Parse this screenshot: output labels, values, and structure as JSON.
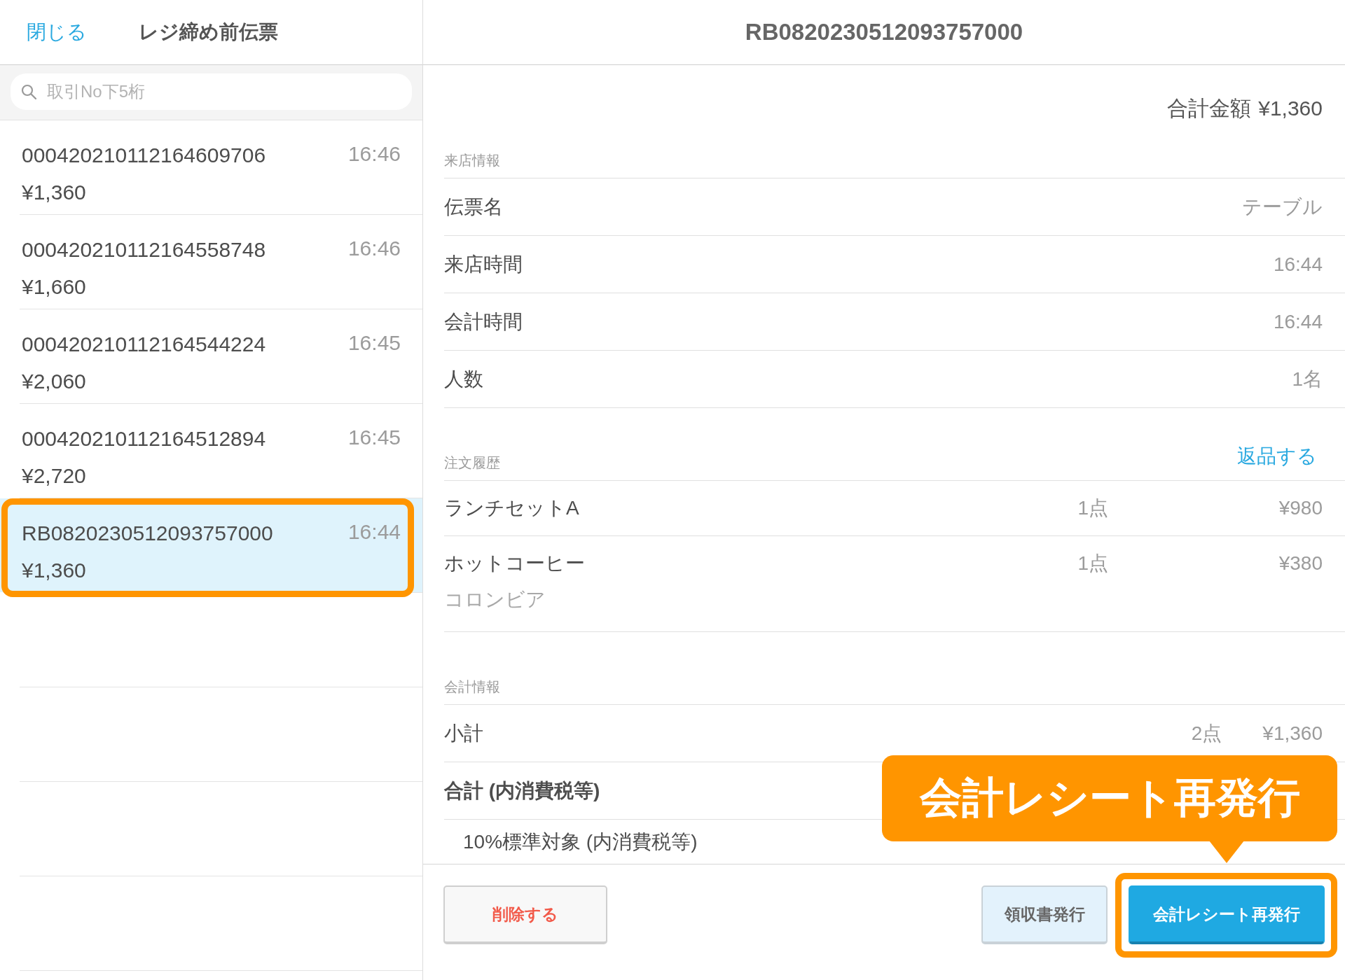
{
  "header": {
    "close_label": "閉じる",
    "title": "レジ締め前伝票"
  },
  "search": {
    "placeholder": "取引No下5桁"
  },
  "slips": [
    {
      "number": "000420210112164609706",
      "time": "16:46",
      "amount": "¥1,360",
      "selected": false,
      "highlighted": false
    },
    {
      "number": "000420210112164558748",
      "time": "16:46",
      "amount": "¥1,660",
      "selected": false,
      "highlighted": false
    },
    {
      "number": "000420210112164544224",
      "time": "16:45",
      "amount": "¥2,060",
      "selected": false,
      "highlighted": false
    },
    {
      "number": "000420210112164512894",
      "time": "16:45",
      "amount": "¥2,720",
      "selected": false,
      "highlighted": false
    },
    {
      "number": "RB0820230512093757000",
      "time": "16:44",
      "amount": "¥1,360",
      "selected": true,
      "highlighted": true
    }
  ],
  "detail": {
    "title": "RB0820230512093757000",
    "total_label": "合計金額",
    "total_amount": "¥1,360",
    "visit_section": {
      "label": "来店情報",
      "rows": [
        {
          "label": "伝票名",
          "value": "テーブル"
        },
        {
          "label": "来店時間",
          "value": "16:44"
        },
        {
          "label": "会計時間",
          "value": "16:44"
        },
        {
          "label": "人数",
          "value": "1名"
        }
      ]
    },
    "order_section": {
      "label": "注文履歴",
      "action": "返品する",
      "items": [
        {
          "name": "ランチセットA",
          "quantity": "1点",
          "price": "¥980"
        },
        {
          "name": "ホットコーヒー",
          "option": "コロンビア",
          "quantity": "1点",
          "price": "¥380"
        }
      ]
    },
    "payment_section": {
      "label": "会計情報",
      "rows": [
        {
          "kind": "count",
          "label": "小計",
          "count": "2点",
          "value": "¥1,360"
        },
        {
          "kind": "bold",
          "label": "合計 (内消費税等)"
        },
        {
          "kind": "indent",
          "label": "10%標準対象 (内消費税等)"
        }
      ]
    }
  },
  "footer_buttons": [
    {
      "kind": "danger",
      "label": "削除する",
      "highlighted": false
    },
    {
      "kind": "secondary",
      "label": "領収書発行",
      "highlighted": false
    },
    {
      "kind": "primary",
      "label": "会計レシート再発行",
      "highlighted": true
    }
  ],
  "callout": {
    "text": "会計レシート再発行"
  }
}
